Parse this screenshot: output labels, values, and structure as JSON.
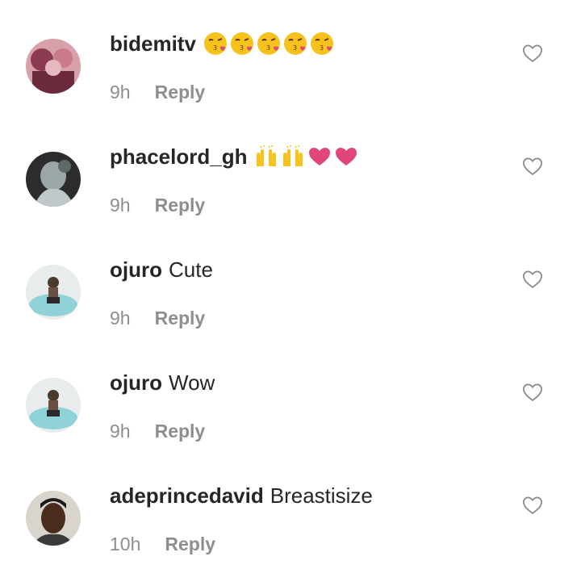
{
  "comments": [
    {
      "username": "bidemitv",
      "text": "",
      "emoji": [
        "kissing-heart",
        "kissing-heart",
        "kissing-heart",
        "kissing-heart",
        "kissing-heart"
      ],
      "time": "9h",
      "reply_label": "Reply"
    },
    {
      "username": "phacelord_gh",
      "text": "",
      "emoji": [
        "raising-hands",
        "raising-hands",
        "red-heart",
        "red-heart"
      ],
      "time": "9h",
      "reply_label": "Reply"
    },
    {
      "username": "ojuro",
      "text": "Cute",
      "emoji": [],
      "time": "9h",
      "reply_label": "Reply"
    },
    {
      "username": "ojuro",
      "text": "Wow",
      "emoji": [],
      "time": "9h",
      "reply_label": "Reply"
    },
    {
      "username": "adeprincedavid",
      "text": "Breastisize",
      "emoji": [],
      "time": "10h",
      "reply_label": "Reply"
    }
  ],
  "colors": {
    "secondary_text": "#8e8e8e",
    "primary_text": "#262626",
    "heart": "#e0457b",
    "emoji_yellow": "#f7c21d"
  }
}
